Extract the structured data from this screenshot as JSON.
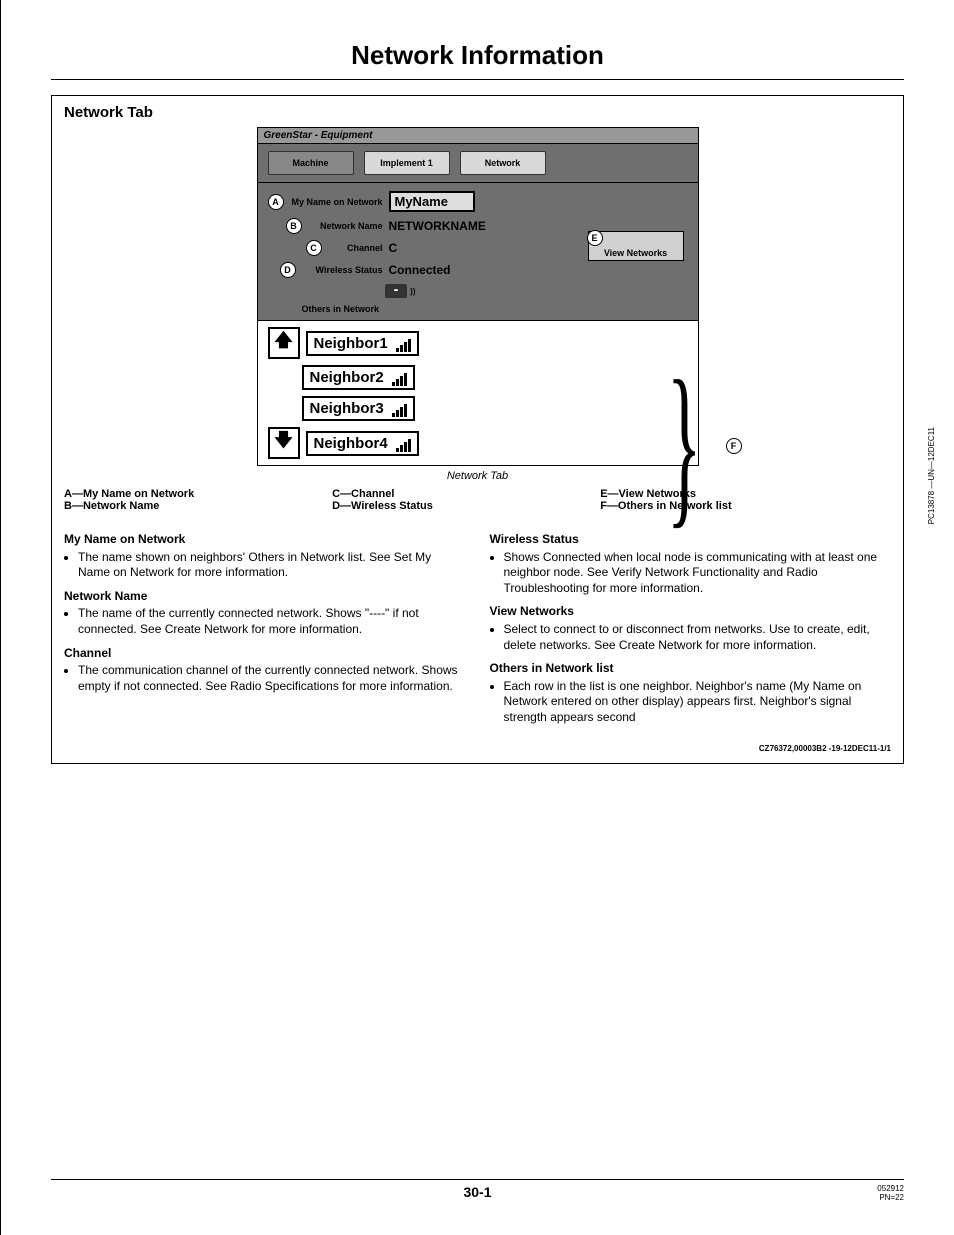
{
  "page": {
    "title": "Network Information",
    "section_heading": "Network Tab",
    "page_number": "30-1",
    "footer_date": "052912",
    "footer_pn": "PN=22",
    "doc_id": "CZ76372,00003B2 -19-12DEC11-1/1",
    "image_code": "PC13878 —UN—12DEC11"
  },
  "device": {
    "header": "GreenStar - Equipment",
    "tabs": [
      "Machine",
      "Implement 1",
      "Network"
    ],
    "fields": {
      "A": {
        "label": "My Name on Network",
        "value": "MyName"
      },
      "B": {
        "label": "Network Name",
        "value": "NETWORKNAME"
      },
      "C": {
        "label": "Channel",
        "value": "C"
      },
      "D": {
        "label": "Wireless Status",
        "value": "Connected"
      }
    },
    "view_networks_label": "View Networks",
    "others_label": "Others in Network",
    "neighbors": [
      "Neighbor1",
      "Neighbor2",
      "Neighbor3",
      "Neighbor4"
    ],
    "caption": "Network Tab"
  },
  "legend": {
    "A": "My Name on Network",
    "B": "Network Name",
    "C": "Channel",
    "D": "Wireless Status",
    "E": "View Networks",
    "F": "Others in Network list"
  },
  "text": {
    "h_myname": "My Name on Network",
    "p_myname": "The name shown on neighbors' Others in Network list. See Set My Name on Network for more information.",
    "h_netname": "Network Name",
    "p_netname": "The name of the currently connected network. Shows \"----\" if not connected. See Create Network for more information.",
    "h_channel": "Channel",
    "p_channel": "The communication channel of the currently connected network. Shows empty if not connected. See Radio Specifications for more information.",
    "h_wstatus": "Wireless Status",
    "p_wstatus": "Shows Connected when local node is communicating with at least one neighbor node. See Verify Network Functionality and Radio Troubleshooting for more information.",
    "h_viewnet": "View Networks",
    "p_viewnet": "Select to connect to or disconnect from networks. Use to create, edit, delete networks. See Create Network for more information.",
    "h_others": "Others in Network list",
    "p_others": "Each row in the list is one neighbor. Neighbor's name (My Name on Network entered on other display) appears first. Neighbor's signal strength appears second"
  }
}
